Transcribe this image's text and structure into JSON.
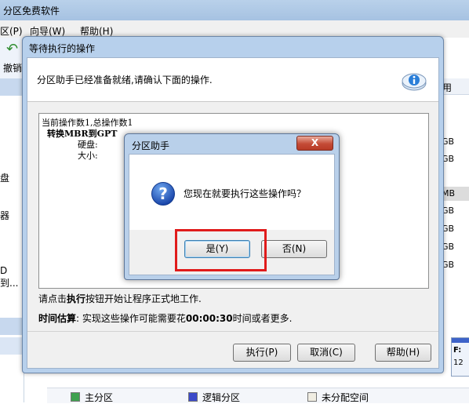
{
  "app": {
    "title": "分区免费软件",
    "menu": [
      "区(P)",
      "向导(W)",
      "帮助(H)"
    ],
    "toolbar_undo": "撤销",
    "left_labels": [
      "盘",
      "器",
      "D到..."
    ],
    "right_col_header": "用",
    "right_values": [
      "GB",
      "GB",
      "MB",
      "GB",
      "GB",
      "GB",
      "GB"
    ],
    "right_drive": "F: ",
    "right_drive_num": "12",
    "legend": {
      "primary": "主分区",
      "logical": "逻辑分区",
      "unallocated": "未分配空间",
      "colors": {
        "primary": "#3fa14f",
        "logical": "#3b49c9",
        "unallocated": "#f0ede2"
      }
    }
  },
  "pending_dialog": {
    "title": "等待执行的操作",
    "header_message": "分区助手已经准备就绪,请确认下面的操作.",
    "ops_summary": "当前操作数1,总操作数1",
    "op_title": "转换MBR到GPT",
    "op_disk_label": "硬盘:",
    "op_size_label": "大小:",
    "hint_prefix": "请点击",
    "hint_bold": "执行",
    "hint_suffix": "按钮开始让程序正式地工作.",
    "estimate_label": "时间估算",
    "estimate_prefix": ": 实现这些操作可能需要花",
    "estimate_time": "00:00:30",
    "estimate_suffix": "时间或者更多.",
    "buttons": {
      "execute": "执行(P)",
      "cancel": "取消(C)",
      "help": "帮助(H)"
    }
  },
  "confirm_dialog": {
    "title": "分区助手",
    "close": "X",
    "message": "您现在就要执行这些操作吗？",
    "yes": "是(Y)",
    "no": "否(N)"
  }
}
